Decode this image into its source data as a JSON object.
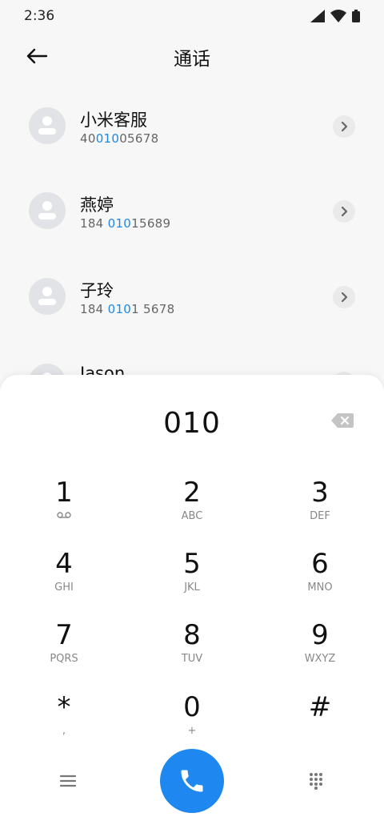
{
  "status": {
    "time": "2:36"
  },
  "header": {
    "title": "通话"
  },
  "contacts": [
    {
      "name": "小米客服",
      "num_pre": "40",
      "num_hl": "010",
      "num_post": "05678"
    },
    {
      "name": "燕婷",
      "num_pre": "184 ",
      "num_hl": "010",
      "num_post": "15689"
    },
    {
      "name": "子玲",
      "num_pre": "184 ",
      "num_hl": "010",
      "num_post": "1 5678"
    },
    {
      "name": "Jason",
      "num_pre": "",
      "num_hl": "",
      "num_post": ""
    }
  ],
  "dialer": {
    "typed": "010",
    "keys": [
      {
        "digit": "1",
        "letters": ""
      },
      {
        "digit": "2",
        "letters": "ABC"
      },
      {
        "digit": "3",
        "letters": "DEF"
      },
      {
        "digit": "4",
        "letters": "GHI"
      },
      {
        "digit": "5",
        "letters": "JKL"
      },
      {
        "digit": "6",
        "letters": "MNO"
      },
      {
        "digit": "7",
        "letters": "PQRS"
      },
      {
        "digit": "8",
        "letters": "TUV"
      },
      {
        "digit": "9",
        "letters": "WXYZ"
      },
      {
        "digit": "*",
        "letters": ","
      },
      {
        "digit": "0",
        "letters": "+"
      },
      {
        "digit": "#",
        "letters": ""
      }
    ]
  },
  "icons": {
    "back": "arrow-left-icon",
    "chevron": "chevron-right-icon",
    "backspace": "backspace-icon",
    "voicemail": "voicemail-icon",
    "menu": "menu-icon",
    "call": "phone-icon",
    "dialpad": "dialpad-icon"
  },
  "colors": {
    "accent": "#1e88f0",
    "highlight": "#1e88e5"
  }
}
